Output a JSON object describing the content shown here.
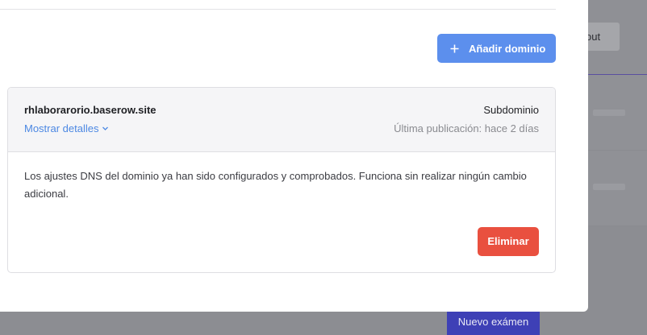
{
  "background": {
    "logout_label": "out",
    "new_exam_label": "Nuevo exámen"
  },
  "modal": {
    "add_domain_label": "Añadir dominio",
    "domain": {
      "name": "rhlaborarorio.baserow.site",
      "show_details_label": "Mostrar detalles",
      "type": "Subdominio",
      "last_publication": "Última publicación: hace 2 días",
      "description": "Los ajustes DNS del dominio ya han sido configurados y comprobados. Funciona sin realizar ningún cambio adicional.",
      "delete_label": "Eliminar"
    }
  },
  "colors": {
    "primary": "#5c8fed",
    "danger": "#e9503f",
    "link": "#4c88e3",
    "overlay": "#8c8d92",
    "new_exam_bg": "#3e40b6"
  },
  "icons": {
    "add": "plus-icon",
    "expand": "chevron-down-icon"
  }
}
